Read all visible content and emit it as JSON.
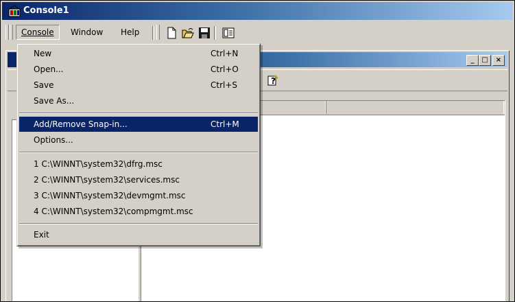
{
  "window": {
    "title": "Console1"
  },
  "menubar": {
    "items": [
      {
        "label": "Console",
        "open": true
      },
      {
        "label": "Window"
      },
      {
        "label": "Help"
      }
    ]
  },
  "toolbar": {
    "icons": [
      "new-document-icon",
      "open-folder-icon",
      "save-disk-icon",
      "properties-icon"
    ]
  },
  "child_window": {
    "caption_buttons": [
      "_",
      "□",
      "×"
    ],
    "toolbar_icons": [
      "help-icon"
    ]
  },
  "console_menu": {
    "items": [
      {
        "label": "New",
        "shortcut": "Ctrl+N"
      },
      {
        "label": "Open...",
        "shortcut": "Ctrl+O"
      },
      {
        "label": "Save",
        "shortcut": "Ctrl+S"
      },
      {
        "label": "Save As..."
      },
      {
        "label": "Add/Remove Snap-in...",
        "shortcut": "Ctrl+M",
        "highlighted": true
      },
      {
        "label": "Options..."
      },
      {
        "label": "1 C:\\WINNT\\system32\\dfrg.msc"
      },
      {
        "label": "2 C:\\WINNT\\system32\\services.msc"
      },
      {
        "label": "3 C:\\WINNT\\system32\\devmgmt.msc"
      },
      {
        "label": "4 C:\\WINNT\\system32\\compmgmt.msc"
      },
      {
        "label": "Exit"
      }
    ]
  },
  "colors": {
    "title_bar_start": "#0a246a",
    "title_bar_end": "#a6caf0",
    "menu_highlight": "#0a246a",
    "face": "#d4d0c8"
  }
}
